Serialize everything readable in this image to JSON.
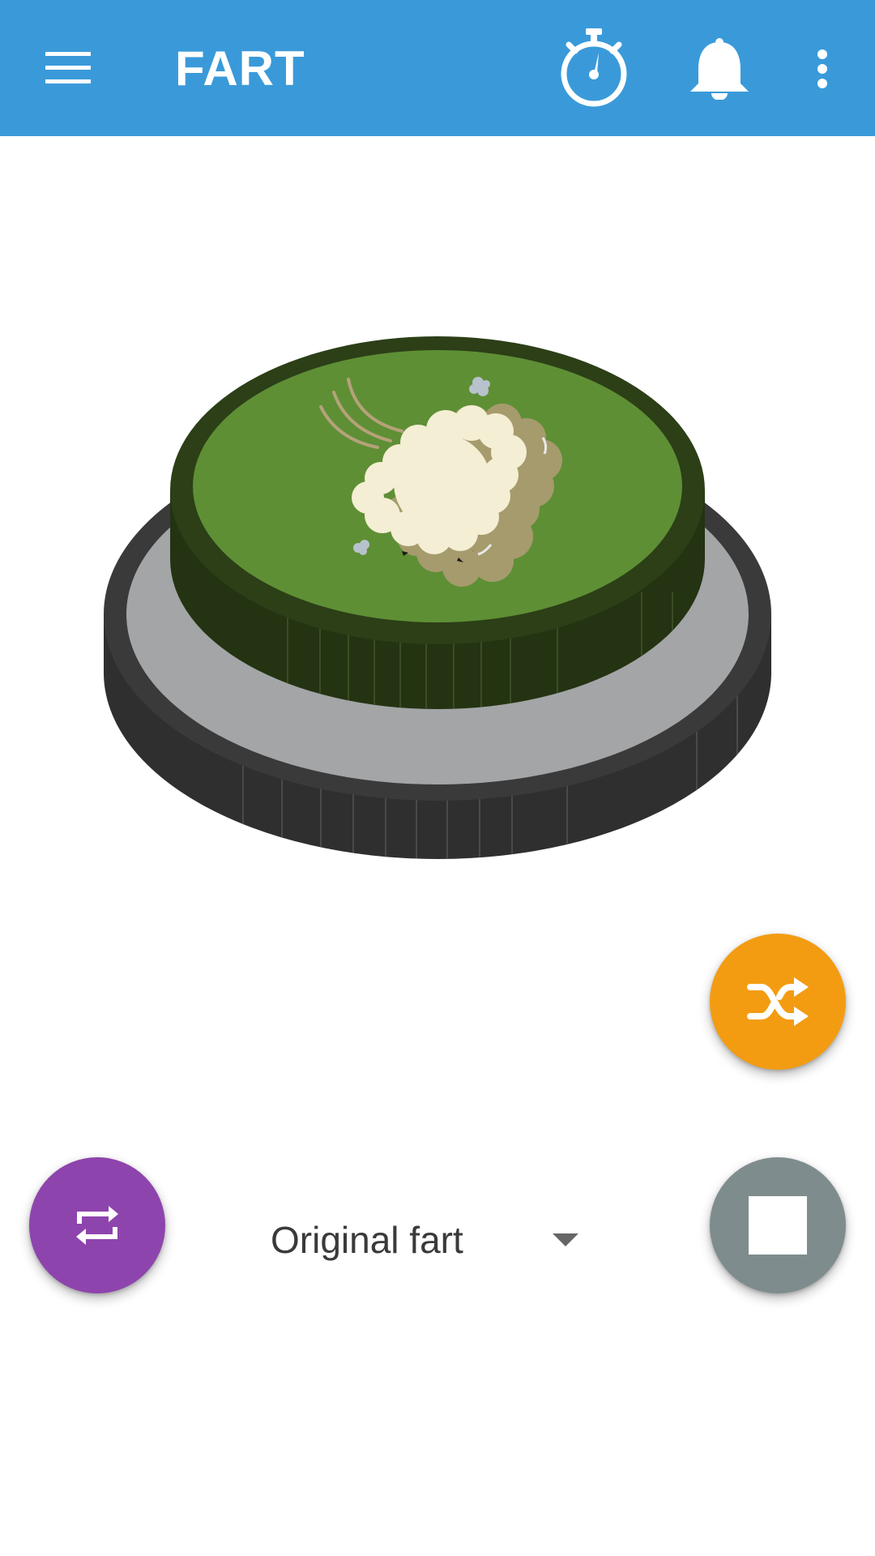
{
  "app_bar": {
    "title": "FART",
    "background_color": "#3a9ad9",
    "icons": [
      "hamburger-menu-icon",
      "stopwatch-icon",
      "bell-icon",
      "more-vert-icon"
    ]
  },
  "fart_button": {
    "icon": "fart-cloud-icon",
    "top_color": "#5e8f35",
    "rim_color": "#2c3f17",
    "base_color": "#a3a5a7",
    "body_color": "#333333"
  },
  "fabs": {
    "shuffle": {
      "icon": "shuffle-icon",
      "color": "#f39c12"
    },
    "repeat": {
      "icon": "repeat-icon",
      "color": "#8e44ad"
    },
    "stop": {
      "icon": "stop-icon",
      "color": "#7f8c8d"
    }
  },
  "sound_selector": {
    "selected": "Original fart",
    "icon": "dropdown-arrow-icon"
  }
}
